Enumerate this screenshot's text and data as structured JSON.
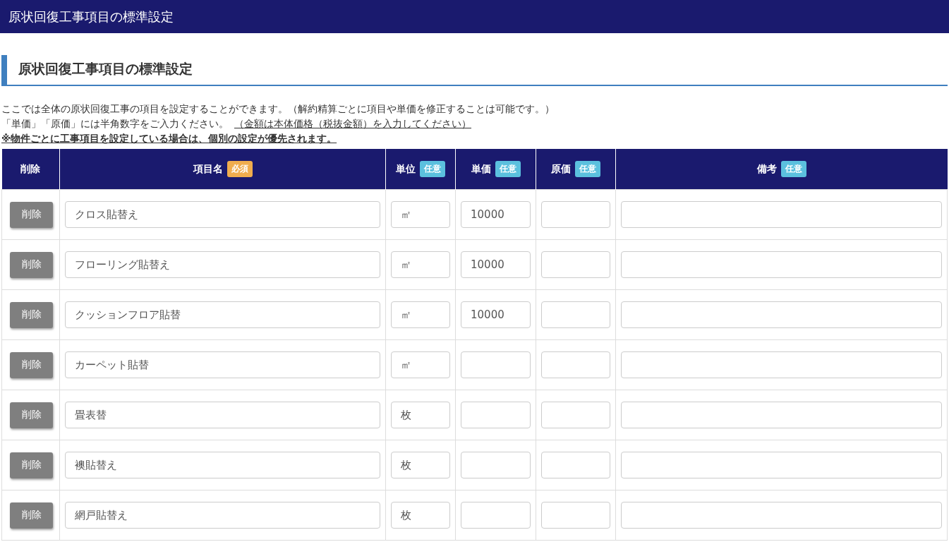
{
  "top_bar": {
    "title": "原状回復工事項目の標準設定"
  },
  "heading": "原状回復工事項目の標準設定",
  "description": {
    "line_1": "ここでは全体の原状回復工事の項目を設定することができます。（解約精算ごとに項目や単価を修正することは可能です。）",
    "line_2": "「単価」「原価」には半角数字をご入力ください。",
    "line_2_note": "（金額は本体価格（税抜金額）を入力してください）",
    "warning": "※物件ごとに工事項目を設定している場合は、個別の設定が優先されます。"
  },
  "table": {
    "columns": [
      {
        "label": "削除"
      },
      {
        "label": "項目名",
        "badge": {
          "text": "必須",
          "kind": "required"
        }
      },
      {
        "label": "単位",
        "badge": {
          "text": "任意",
          "kind": "optional"
        }
      },
      {
        "label": "単価",
        "badge": {
          "text": "任意",
          "kind": "optional"
        }
      },
      {
        "label": "原価",
        "badge": {
          "text": "任意",
          "kind": "optional"
        }
      },
      {
        "label": "備考",
        "badge": {
          "text": "任意",
          "kind": "optional"
        }
      }
    ],
    "rows": [
      {
        "delete": "削除",
        "name": "クロス貼替え",
        "unit": "㎡",
        "price": "10000"
      },
      {
        "delete": "削除",
        "name": "フローリング貼替え",
        "unit": "㎡",
        "price": "10000"
      },
      {
        "delete": "削除",
        "name": "クッションフロア貼替",
        "unit": "㎡",
        "price": "10000"
      },
      {
        "delete": "削除",
        "name": "カーペット貼替",
        "unit": "㎡"
      },
      {
        "delete": "削除",
        "name": "畳表替",
        "unit": "枚"
      },
      {
        "delete": "削除",
        "name": "襖貼替え",
        "unit": "枚"
      },
      {
        "delete": "削除",
        "name": "網戸貼替え",
        "unit": "枚"
      }
    ]
  }
}
